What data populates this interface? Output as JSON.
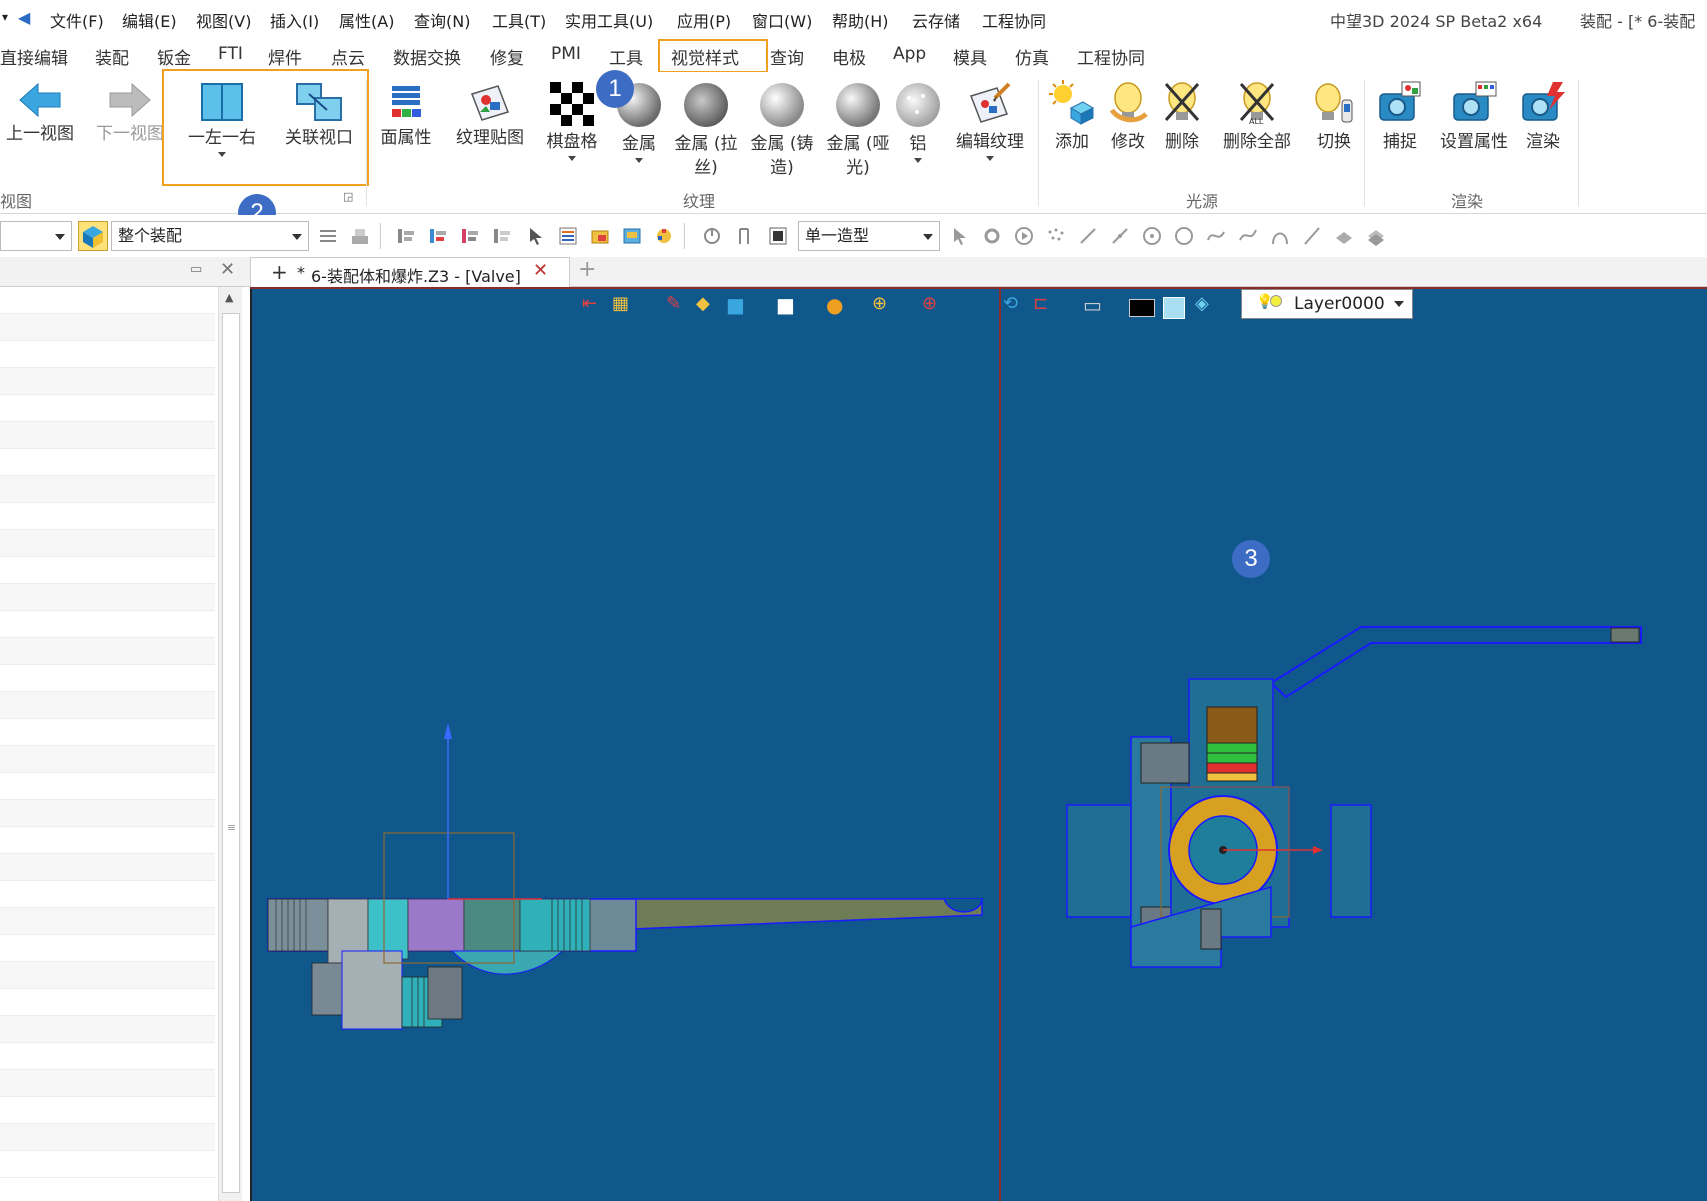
{
  "menubar": {
    "items": [
      "文件(F)",
      "编辑(E)",
      "视图(V)",
      "插入(I)",
      "属性(A)",
      "查询(N)",
      "工具(T)",
      "实用工具(U)",
      "应用(P)",
      "窗口(W)",
      "帮助(H)",
      "云存储",
      "工程协同"
    ],
    "app_title": "中望3D 2024 SP Beta2 x64",
    "doc_title": "装配 - [* 6-装配"
  },
  "ribbon_tabs": [
    "直接编辑",
    "装配",
    "钣金",
    "FTI",
    "焊件",
    "点云",
    "数据交换",
    "修复",
    "PMI",
    "工具",
    "视觉样式",
    "查询",
    "电极",
    "App",
    "模具",
    "仿真",
    "工程协同"
  ],
  "ribbon": {
    "view_group": {
      "label": "视图",
      "prev": "上一视图",
      "next": "下一视图",
      "split": "一左一右",
      "link": "关联视口"
    },
    "texture_group": {
      "label": "纹理",
      "face_attr": "面属性",
      "texture_map": "纹理贴图",
      "checker": "棋盘格",
      "metal": "金属",
      "metal_brushed": "金属 (拉",
      "metal_brushed_2": "丝)",
      "metal_cast": "金属 (铸",
      "metal_cast_2": "造)",
      "metal_matte": "金属 (哑",
      "metal_matte_2": "光)",
      "aluminum": "铝",
      "edit_texture": "编辑纹理"
    },
    "light_group": {
      "label": "光源",
      "add": "添加",
      "modify": "修改",
      "delete": "删除",
      "delete_all": "删除全部",
      "switch": "切换"
    },
    "render_group": {
      "label": "渲染",
      "capture": "捕捉",
      "set_attr": "设置属性",
      "render": "渲染"
    }
  },
  "toolbar2": {
    "filter_value": "整个装配",
    "shape_value": "单一造型"
  },
  "doc_tab": {
    "modified_mark": "*",
    "label": "6-装配体和爆炸.Z3 - [Valve]"
  },
  "viewport": {
    "layer": "Layer0000"
  },
  "callouts": [
    "1",
    "2",
    "3"
  ],
  "colors": {
    "highlight": "#f0a020",
    "callout": "#3d6cc4",
    "viewport_bg": "#10578c"
  }
}
